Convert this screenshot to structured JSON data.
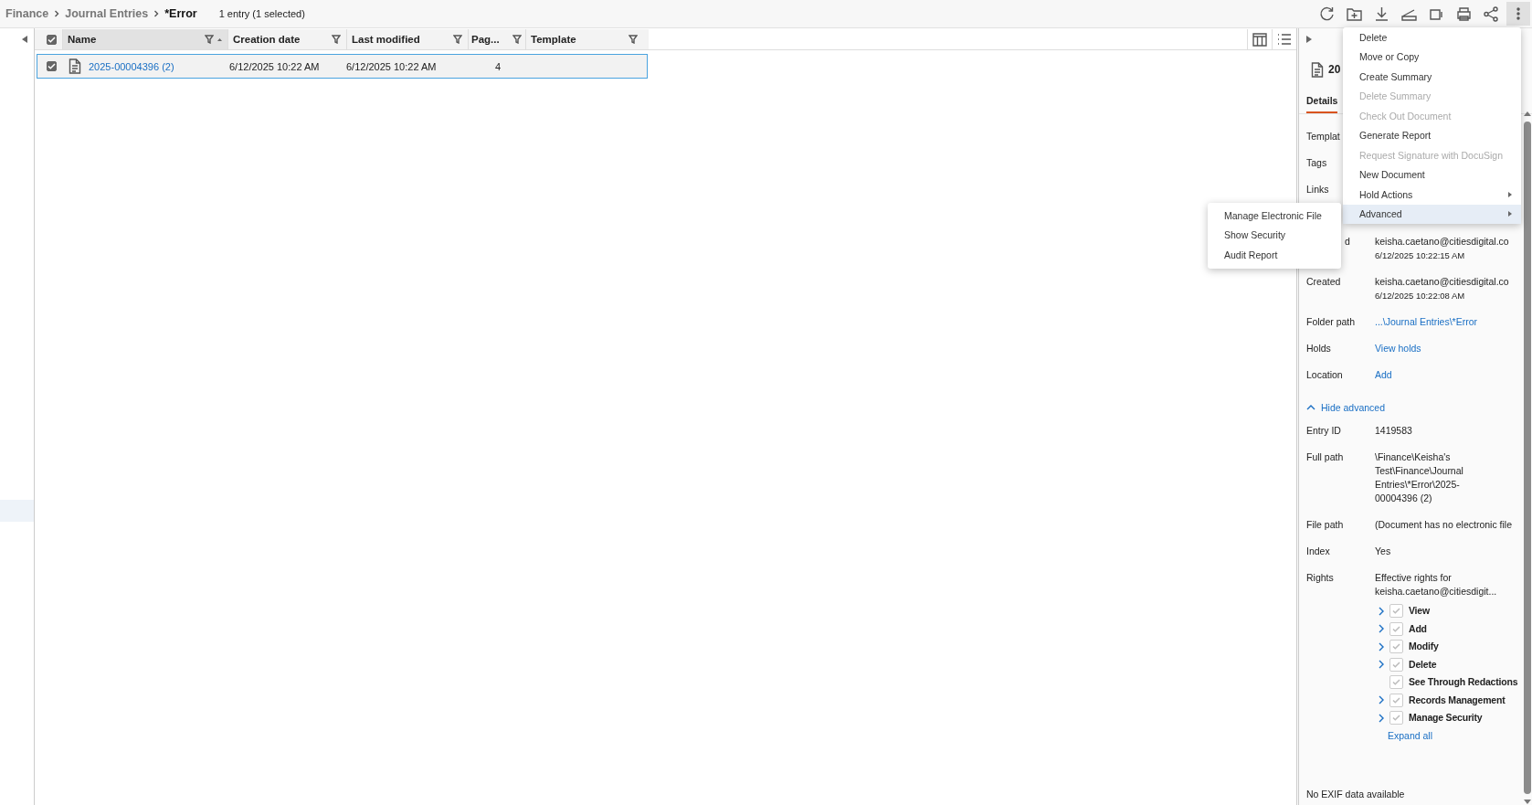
{
  "breadcrumb": [
    {
      "label": "Finance",
      "selected": false
    },
    {
      "label": "Journal Entries",
      "selected": false
    },
    {
      "label": "*Error",
      "selected": true
    }
  ],
  "entry_count": "1 entry (1 selected)",
  "toolbar": [
    {
      "kind": "refresh",
      "pressed": false
    },
    {
      "kind": "new-folder",
      "pressed": false
    },
    {
      "kind": "download",
      "pressed": false
    },
    {
      "kind": "scan",
      "pressed": false
    },
    {
      "kind": "panel",
      "pressed": false
    },
    {
      "kind": "print",
      "pressed": false
    },
    {
      "kind": "share",
      "pressed": false
    },
    {
      "kind": "more",
      "pressed": true
    }
  ],
  "table": {
    "select_all_checked": true,
    "columns": [
      {
        "label": "Name",
        "sorted": true
      },
      {
        "label": "Creation date",
        "sorted": false
      },
      {
        "label": "Last modified",
        "sorted": false
      },
      {
        "label": "Pag...",
        "sorted": false
      },
      {
        "label": "Template",
        "sorted": false
      }
    ],
    "rows": [
      {
        "selected": true,
        "checked": true,
        "name": "2025-00004396 (2)",
        "creation_date": "6/12/2025 10:22 AM",
        "last_modified": "6/12/2025 10:22 AM",
        "pages": "4"
      }
    ],
    "tools": [
      {
        "kind": "columns"
      },
      {
        "kind": "list"
      }
    ]
  },
  "details": {
    "title": "20",
    "tabs": [
      {
        "label": "Details",
        "selected": true
      }
    ],
    "fields": [
      {
        "kind": "text",
        "label": "Templat"
      },
      {
        "kind": "text",
        "label": "Tags"
      },
      {
        "kind": "text",
        "label": "Links"
      },
      {
        "kind": "gap"
      },
      {
        "kind": "text",
        "label": "d",
        "clipped": true,
        "value": "keisha.caetano@citiesdigital.co",
        "sub": "6/12/2025 10:22:15 AM"
      },
      {
        "kind": "text",
        "label": "Created",
        "value": "keisha.caetano@citiesdigital.co",
        "sub": "6/12/2025 10:22:08 AM"
      },
      {
        "kind": "link",
        "label": "Folder path",
        "value": "...\\Journal Entries\\*Error"
      },
      {
        "kind": "link",
        "label": "Holds",
        "value": "View holds"
      },
      {
        "kind": "link",
        "label": "Location",
        "value": "Add"
      }
    ],
    "advanced_toggle": {
      "label": "Hide advanced",
      "expanded": true
    },
    "advanced_fields": [
      {
        "kind": "text",
        "label": "Entry ID",
        "value": "1419583"
      },
      {
        "kind": "text",
        "label": "Full path",
        "value": "\\Finance\\Keisha's Test\\Finance\\Journal Entries\\*Error\\2025-00004396 (2)"
      },
      {
        "kind": "text",
        "label": "File path",
        "value": "(Document has no electronic file"
      },
      {
        "kind": "text",
        "label": "Index",
        "value": "Yes"
      }
    ],
    "rights": {
      "label": "Rights",
      "intro": "Effective rights for keisha.caetano@citiesdigit...",
      "items": [
        {
          "label": "View",
          "checked": true,
          "expandable": true
        },
        {
          "label": "Add",
          "checked": true,
          "expandable": true
        },
        {
          "label": "Modify",
          "checked": true,
          "expandable": true
        },
        {
          "label": "Delete",
          "checked": true,
          "expandable": true
        },
        {
          "label": "See Through Redactions",
          "checked": true,
          "expandable": false
        },
        {
          "label": "Records Management",
          "checked": true,
          "expandable": true
        },
        {
          "label": "Manage Security",
          "checked": true,
          "expandable": true
        }
      ],
      "expand_all": "Expand all"
    },
    "exif": "No EXIF data available"
  },
  "menu": [
    {
      "label": "Delete",
      "disabled": false,
      "submenu": false,
      "selected": false
    },
    {
      "label": "Move or Copy",
      "disabled": false,
      "submenu": false,
      "selected": false
    },
    {
      "label": "Create Summary",
      "disabled": false,
      "submenu": false,
      "selected": false
    },
    {
      "label": "Delete Summary",
      "disabled": true,
      "submenu": false,
      "selected": false
    },
    {
      "label": "Check Out Document",
      "disabled": true,
      "submenu": false,
      "selected": false
    },
    {
      "label": "Generate Report",
      "disabled": false,
      "submenu": false,
      "selected": false
    },
    {
      "label": "Request Signature with DocuSign",
      "disabled": true,
      "submenu": false,
      "selected": false
    },
    {
      "label": "New Document",
      "disabled": false,
      "submenu": false,
      "selected": false
    },
    {
      "label": "Hold Actions",
      "disabled": false,
      "submenu": true,
      "selected": false
    },
    {
      "label": "Advanced",
      "disabled": false,
      "submenu": true,
      "selected": true
    }
  ],
  "submenu": [
    {
      "label": "Manage Electronic File"
    },
    {
      "label": "Show Security"
    },
    {
      "label": "Audit Report"
    }
  ]
}
